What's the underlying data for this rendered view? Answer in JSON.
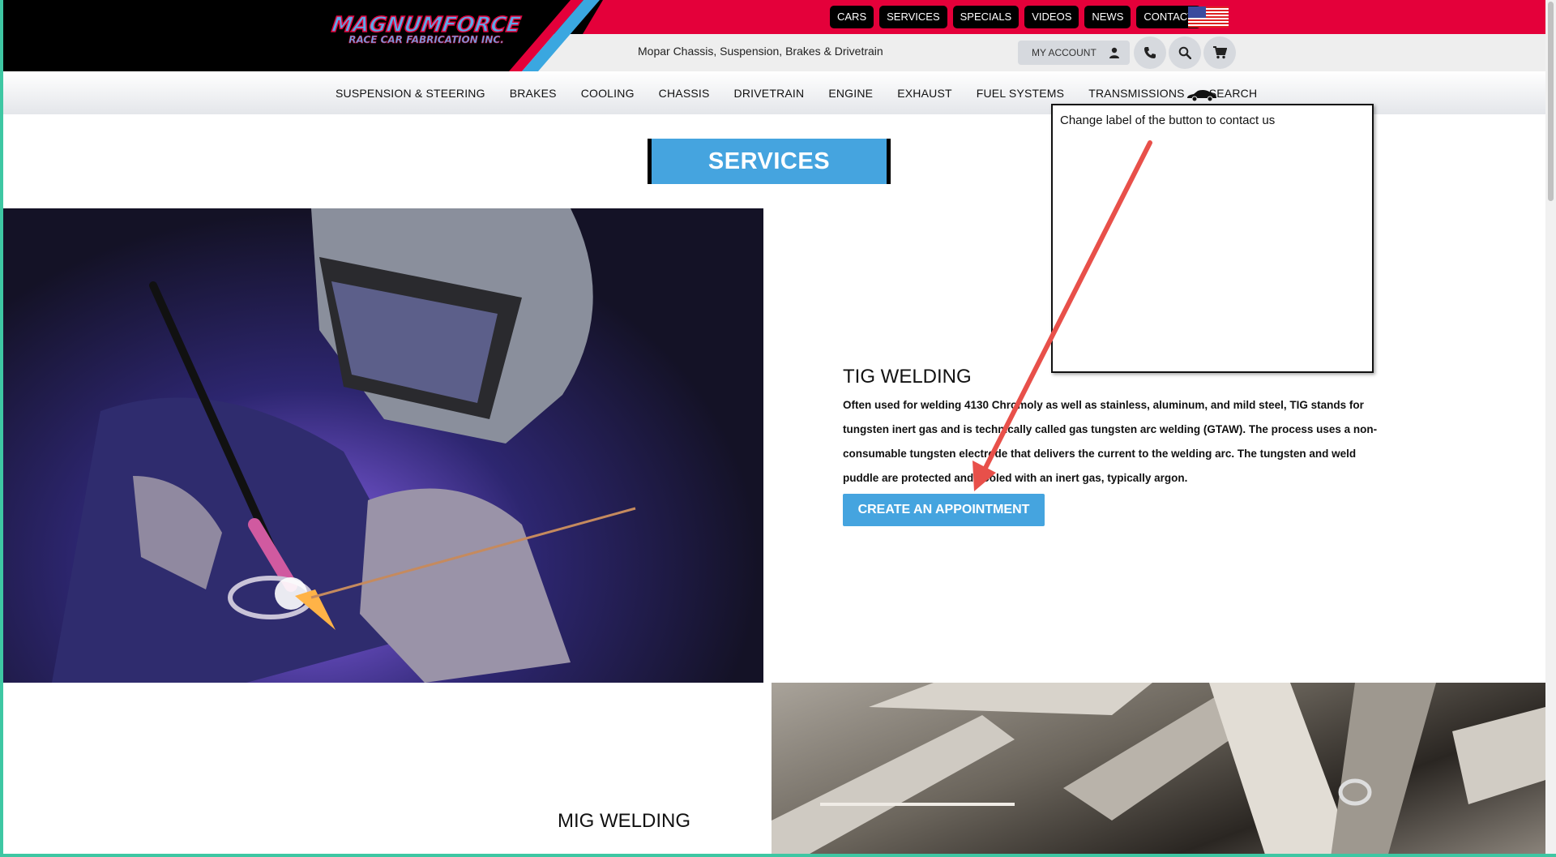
{
  "header": {
    "logo": {
      "main": "MAGNUMFORCE",
      "sub": "RACE CAR FABRICATION INC."
    },
    "tagline": "Mopar Chassis, Suspension, Brakes & Drivetrain",
    "top_nav": [
      "CARS",
      "SERVICES",
      "SPECIALS",
      "VIDEOS",
      "NEWS",
      "CONTACT"
    ],
    "account_label": "MY ACCOUNT",
    "icons": {
      "account": "user-icon",
      "phone": "phone-icon",
      "search": "search-icon",
      "cart": "cart-icon",
      "flag": "us-flag-icon"
    }
  },
  "main_nav": [
    "SUSPENSION & STEERING",
    "BRAKES",
    "COOLING",
    "CHASSIS",
    "DRIVETRAIN",
    "ENGINE",
    "EXHAUST",
    "FUEL SYSTEMS",
    "TRANSMISSIONS",
    "SEARCH"
  ],
  "content": {
    "banner": "SERVICES",
    "tig": {
      "title": "TIG WELDING",
      "description": "Often used for welding 4130 Chromoly as well as stainless, aluminum, and mild steel, TIG stands for tungsten inert gas and is technically called gas tungsten arc welding (GTAW). The process uses a non-consumable tungsten electrode that delivers the current to the welding arc. The tungsten and weld puddle are protected and cooled with an inert gas, typically argon.",
      "button": "CREATE AN APPOINTMENT"
    },
    "mig": {
      "title": "MIG WELDING"
    }
  },
  "annotation": {
    "text": "Change label of the button to contact us"
  },
  "colors": {
    "red": "#e4003a",
    "blue": "#45a4df",
    "black": "#000000",
    "arrow": "#e8504a"
  }
}
